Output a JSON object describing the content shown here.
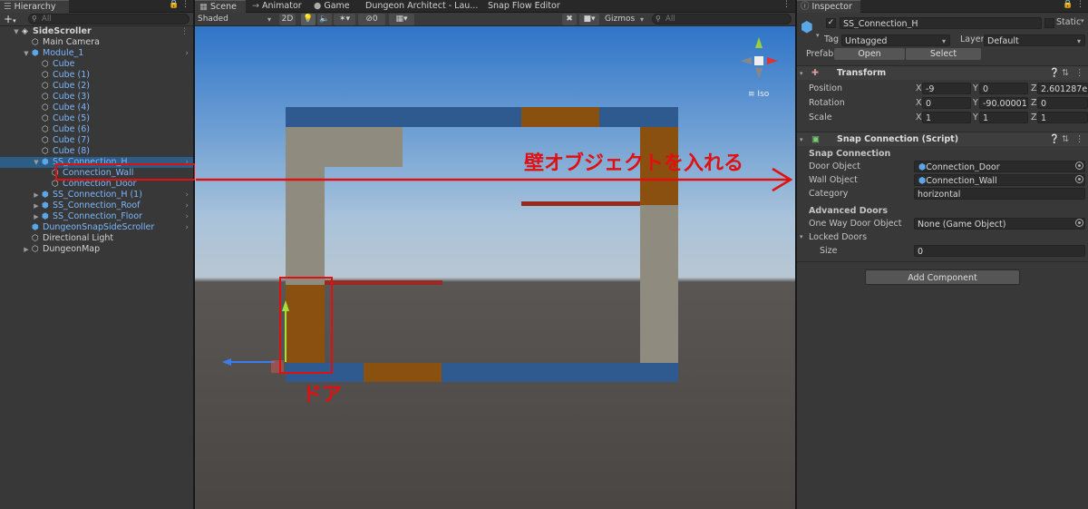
{
  "hierarchy": {
    "tab": "Hierarchy",
    "add": "+",
    "search_placeholder": "All",
    "items": [
      {
        "label": "SideScroller",
        "depth": 0,
        "arrow": "open",
        "icon": "unity",
        "prefab": false,
        "selected": false,
        "bold": true,
        "more": true
      },
      {
        "label": "Main Camera",
        "depth": 1,
        "arrow": "none",
        "icon": "cube",
        "prefab": false,
        "selected": false
      },
      {
        "label": "Module_1",
        "depth": 1,
        "arrow": "open",
        "icon": "prefab",
        "prefab": true,
        "selected": false,
        "chev": true
      },
      {
        "label": "Cube",
        "depth": 2,
        "arrow": "none",
        "icon": "cube",
        "prefab": true,
        "selected": false
      },
      {
        "label": "Cube (1)",
        "depth": 2,
        "arrow": "none",
        "icon": "cube",
        "prefab": true,
        "selected": false
      },
      {
        "label": "Cube (2)",
        "depth": 2,
        "arrow": "none",
        "icon": "cube",
        "prefab": true,
        "selected": false
      },
      {
        "label": "Cube (3)",
        "depth": 2,
        "arrow": "none",
        "icon": "cube",
        "prefab": true,
        "selected": false
      },
      {
        "label": "Cube (4)",
        "depth": 2,
        "arrow": "none",
        "icon": "cube",
        "prefab": true,
        "selected": false
      },
      {
        "label": "Cube (5)",
        "depth": 2,
        "arrow": "none",
        "icon": "cube",
        "prefab": true,
        "selected": false
      },
      {
        "label": "Cube (6)",
        "depth": 2,
        "arrow": "none",
        "icon": "cube",
        "prefab": true,
        "selected": false
      },
      {
        "label": "Cube (7)",
        "depth": 2,
        "arrow": "none",
        "icon": "cube",
        "prefab": true,
        "selected": false
      },
      {
        "label": "Cube (8)",
        "depth": 2,
        "arrow": "none",
        "icon": "cube",
        "prefab": true,
        "selected": false
      },
      {
        "label": "SS_Connection_H",
        "depth": 2,
        "arrow": "open",
        "icon": "prefab",
        "prefab": true,
        "selected": true,
        "chev": true
      },
      {
        "label": "Connection_Wall",
        "depth": 3,
        "arrow": "none",
        "icon": "cube",
        "prefab": true,
        "selected": false
      },
      {
        "label": "Connection_Door",
        "depth": 3,
        "arrow": "none",
        "icon": "cube",
        "prefab": true,
        "selected": false
      },
      {
        "label": "SS_Connection_H (1)",
        "depth": 2,
        "arrow": "closed",
        "icon": "prefab",
        "prefab": true,
        "selected": false,
        "chev": true
      },
      {
        "label": "SS_Connection_Roof",
        "depth": 2,
        "arrow": "closed",
        "icon": "prefab",
        "prefab": true,
        "selected": false,
        "chev": true
      },
      {
        "label": "SS_Connection_Floor",
        "depth": 2,
        "arrow": "closed",
        "icon": "prefab",
        "prefab": true,
        "selected": false,
        "chev": true
      },
      {
        "label": "DungeonSnapSideScroller",
        "depth": 1,
        "arrow": "none",
        "icon": "prefab",
        "prefab": true,
        "selected": false,
        "chev": true
      },
      {
        "label": "Directional Light",
        "depth": 1,
        "arrow": "none",
        "icon": "cube",
        "prefab": false,
        "selected": false
      },
      {
        "label": "DungeonMap",
        "depth": 1,
        "arrow": "closed",
        "icon": "cube",
        "prefab": false,
        "selected": false
      }
    ]
  },
  "tabs": {
    "scene": "Scene",
    "animator": "Animator",
    "game": "Game",
    "dungeon_architect": "Dungeon Architect - Lau...",
    "snap_flow": "Snap Flow Editor",
    "inspector": "Inspector"
  },
  "scene_toolbar": {
    "shading": "Shaded",
    "mode_2d": "2D",
    "hidden_count": "0",
    "gizmos": "Gizmos",
    "search_placeholder": "All",
    "projection": "Iso"
  },
  "annotations": {
    "wall_note": "壁オブジェクトを入れる",
    "door_note": "ドア"
  },
  "inspector": {
    "object_name": "SS_Connection_H",
    "static_label": "Static",
    "tag_label": "Tag",
    "tag_value": "Untagged",
    "layer_label": "Layer",
    "layer_value": "Default",
    "prefab_label": "Prefab",
    "open_button": "Open",
    "select_button": "Select",
    "transform": {
      "title": "Transform",
      "rows": [
        {
          "label": "Position",
          "x": "-9",
          "y": "0",
          "z": "2.601287e-"
        },
        {
          "label": "Rotation",
          "x": "0",
          "y": "-90.00001",
          "z": "0"
        },
        {
          "label": "Scale",
          "x": "1",
          "y": "1",
          "z": "1"
        }
      ],
      "x_axis": "X",
      "y_axis": "Y",
      "z_axis": "Z"
    },
    "snap": {
      "title": "Snap Connection (Script)",
      "section": "Snap Connection",
      "door_label": "Door Object",
      "door_value": "Connection_Door",
      "wall_label": "Wall Object",
      "wall_value": "Connection_Wall",
      "category_label": "Category",
      "category_value": "horizontal",
      "advanced": "Advanced Doors",
      "oneway_label": "One Way Door Object",
      "oneway_value": "None (Game Object)",
      "locked_label": "Locked Doors",
      "size_label": "Size",
      "size_value": "0"
    },
    "add_component": "Add Component"
  },
  "colors": {
    "selection": "#2c5d87",
    "prefab_text": "#7ab8ff",
    "annotation_red": "#e01010",
    "wall_blue": "#2f5a8f",
    "door_orange": "#8a5010",
    "beige": "#8f8b7e"
  }
}
